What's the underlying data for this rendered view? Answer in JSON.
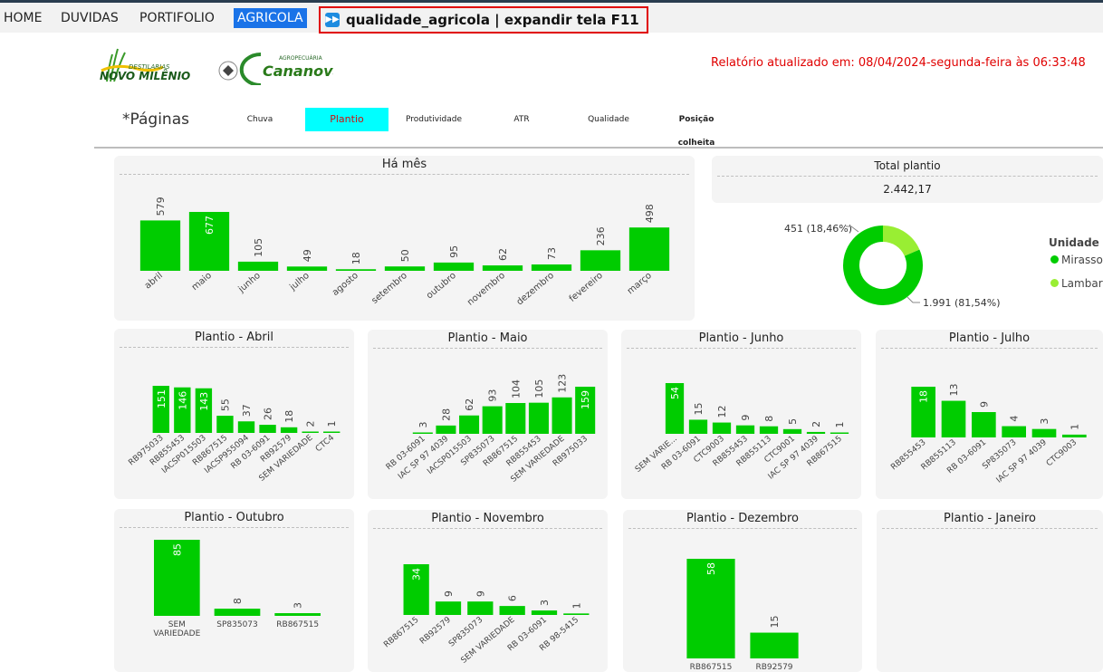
{
  "nav": {
    "home": "HOME",
    "duvidas": "DUVIDAS",
    "portfolio": "PORTIFOLIO",
    "agricola": "AGRICOLA"
  },
  "title_bar": {
    "icon": "fast-forward-icon",
    "text": "qualidade_agricola | expandir tela F11"
  },
  "logos": {
    "brand1_top": "DESTILARIAS",
    "brand1": "NOVO MILÊNIO",
    "brand2_top": "AGROPECUÁRIA",
    "brand2": "Cananova"
  },
  "report": {
    "updated": "Relatório atualizado em: 08/04/2024-segunda-feira às 06:33:48"
  },
  "pages": {
    "label": "*Páginas",
    "tabs": [
      "Chuva",
      "Plantio",
      "Produtividade",
      "ATR",
      "Qualidade",
      "Posição colheita"
    ],
    "active": "Plantio"
  },
  "colors": {
    "bar": "#00cc00",
    "mirassol": "#00cc00",
    "lambari": "#99ee33",
    "active_tab": "#00ffff",
    "title_border": "#e00000"
  },
  "total": {
    "title": "Total plantio",
    "value": "2.442,17"
  },
  "legend": {
    "title": "Unidade",
    "items": [
      "Mirassol",
      "Lambari"
    ]
  },
  "chart_data": [
    {
      "type": "bar",
      "title": "Há mês",
      "categories": [
        "abril",
        "maio",
        "junho",
        "julho",
        "agosto",
        "setembro",
        "outubro",
        "novembro",
        "dezembro",
        "fevereiro",
        "março"
      ],
      "values": [
        579,
        677,
        105,
        49,
        18,
        50,
        95,
        62,
        73,
        236,
        498
      ]
    },
    {
      "type": "pie",
      "title": "",
      "categories": [
        "Mirassol",
        "Lambari"
      ],
      "values": [
        1991,
        451
      ],
      "labels": [
        "1.991 (81,54%)",
        "451 (18,46%)"
      ]
    },
    {
      "type": "bar",
      "title": "Plantio - Abril",
      "categories": [
        "RB975033",
        "RB855453",
        "IACSP015503",
        "RB867515",
        "IACSP955094",
        "RB 03-6091",
        "RB92579",
        "SEM VARIEDADE",
        "CTC4"
      ],
      "values": [
        151,
        146,
        143,
        55,
        37,
        26,
        18,
        2,
        1
      ]
    },
    {
      "type": "bar",
      "title": "Plantio - Maio",
      "categories": [
        "RB 03-6091",
        "IAC SP 97 4039",
        "IACSP015503",
        "SP835073",
        "RB867515",
        "RB855453",
        "SEM VARIEDADE",
        "RB975033"
      ],
      "values": [
        3,
        28,
        62,
        93,
        104,
        105,
        123,
        159
      ]
    },
    {
      "type": "bar",
      "title": "Plantio - Junho",
      "categories": [
        "SEM VARIE...",
        "RB 03-6091",
        "CTC9003",
        "RB855453",
        "RB855113",
        "CTC9001",
        "IAC SP 97 4039",
        "RB867515"
      ],
      "values": [
        54,
        15,
        12,
        9,
        8,
        5,
        2,
        1
      ]
    },
    {
      "type": "bar",
      "title": "Plantio - Julho",
      "categories": [
        "RB855453",
        "RB855113",
        "RB 03-6091",
        "SP835073",
        "IAC SP 97 4039",
        "CTC9003"
      ],
      "values": [
        18,
        13,
        9,
        4,
        3,
        1
      ]
    },
    {
      "type": "bar",
      "title": "Plantio - Outubro",
      "categories": [
        "SEM VARIEDADE",
        "SP835073",
        "RB867515"
      ],
      "values": [
        85,
        8,
        3
      ]
    },
    {
      "type": "bar",
      "title": "Plantio - Novembro",
      "categories": [
        "RB867515",
        "RB92579",
        "SP835073",
        "SEM VARIEDADE",
        "RB 03-6091",
        "RB 98-5415"
      ],
      "values": [
        34,
        9,
        9,
        6,
        3,
        1
      ]
    },
    {
      "type": "bar",
      "title": "Plantio - Dezembro",
      "categories": [
        "RB867515",
        "RB92579"
      ],
      "values": [
        58,
        15
      ]
    },
    {
      "type": "bar",
      "title": "Plantio - Janeiro",
      "categories": [],
      "values": []
    }
  ]
}
